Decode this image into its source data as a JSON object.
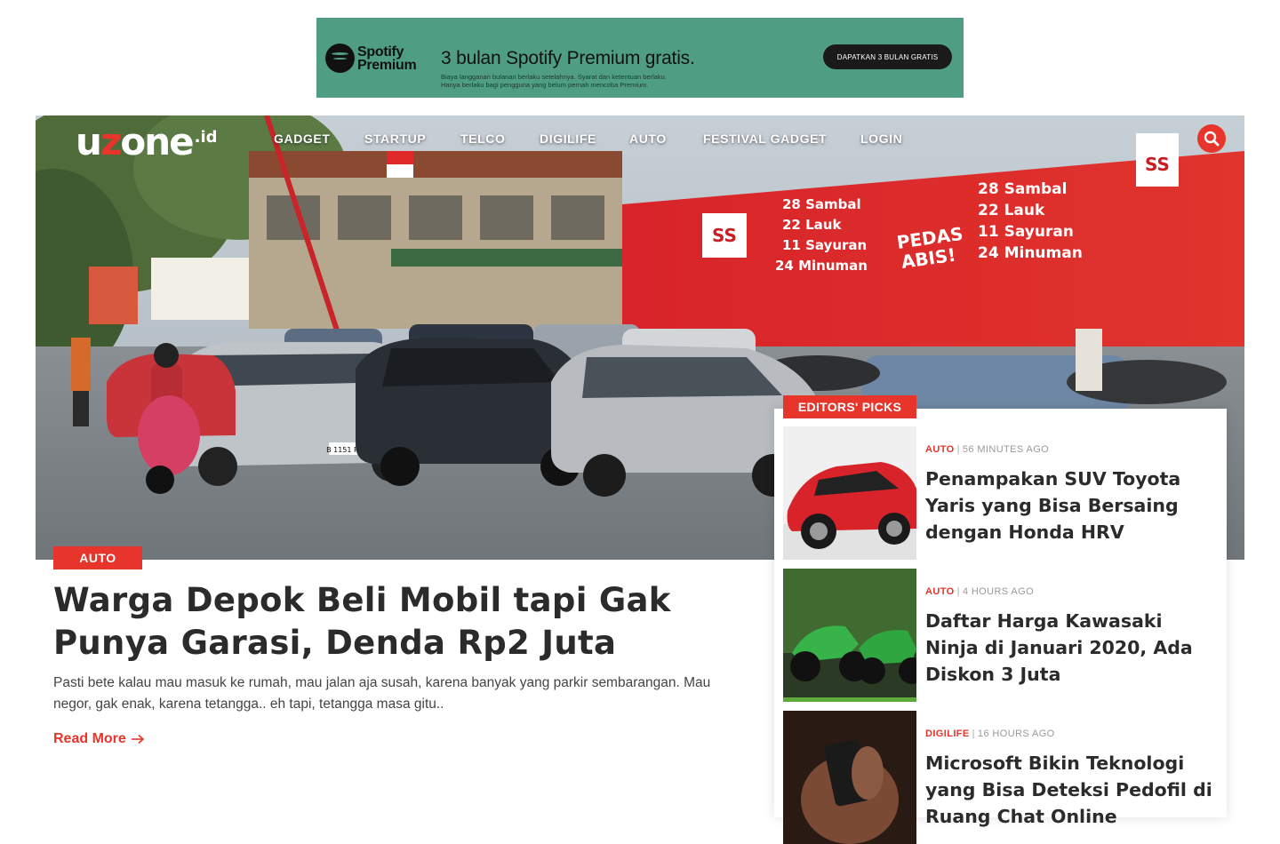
{
  "ad": {
    "brand_line1": "Spotify",
    "brand_line2": "Premium",
    "headline": "3 bulan Spotify Premium gratis.",
    "fine_print_1": "Biaya langganan bulanan berlaku setelahnya. Syarat dan ketentuan berlaku.",
    "fine_print_2": "Hanya berlaku bagi pengguna yang belum pernah mencoba Premium.",
    "cta": "DAPATKAN 3 BULAN GRATIS"
  },
  "header": {
    "logo_u": "u",
    "logo_z": "z",
    "logo_rest": "one",
    "logo_tld": ".id",
    "nav": [
      "GADGET",
      "STARTUP",
      "TELCO",
      "DIGILIFE",
      "AUTO",
      "FESTIVAL GADGET",
      "LOGIN"
    ],
    "search_icon": "search-icon"
  },
  "hero_image": {
    "sign_lines": [
      "28 Sambal",
      "22 Lauk",
      "11 Sayuran",
      "24 Minuman"
    ],
    "sign_logo": "SS",
    "sign_slogan_1": "PEDAS",
    "sign_slogan_2": "ABIS!",
    "plate": "B 1151 PFX"
  },
  "main_article": {
    "category": "AUTO",
    "title": "Warga Depok Beli Mobil tapi Gak Punya Garasi, Denda Rp2 Juta",
    "excerpt": "Pasti bete kalau mau masuk ke rumah, mau jalan aja susah, karena banyak yang parkir sembarangan. Mau negor, gak enak, karena tetangga.. eh tapi, tetangga masa gitu..",
    "read_more": "Read More",
    "read_more_icon": "arrow-right-icon"
  },
  "editors_picks": {
    "label": "EDITORS' PICKS",
    "items": [
      {
        "category": "AUTO",
        "sep": "|",
        "time": "56 MINUTES AGO",
        "title": "Penampakan SUV Toyota Yaris yang Bisa Bersaing dengan Honda HRV"
      },
      {
        "category": "AUTO",
        "sep": "|",
        "time": "4 HOURS AGO",
        "title": "Daftar Harga Kawasaki Ninja di Januari 2020, Ada Diskon 3 Juta"
      },
      {
        "category": "DIGILIFE",
        "sep": "|",
        "time": "16 HOURS AGO",
        "title": "Microsoft Bikin Teknologi yang Bisa Deteksi Pedofil di Ruang Chat Online"
      }
    ]
  },
  "colors": {
    "accent": "#e8352b",
    "ad_bg": "#4f9e84",
    "text_dark": "#2b2b2b"
  }
}
